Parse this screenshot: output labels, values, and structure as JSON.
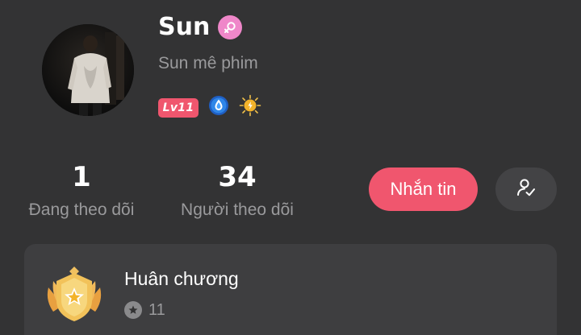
{
  "profile": {
    "username": "Sun",
    "bio": "Sun mê phim",
    "level_badge": "Lv11",
    "gender_icon": "female-symbol-icon",
    "accent_color": "#f0566e",
    "gender_color": "#ef87c9"
  },
  "stats": {
    "following_count": "1",
    "following_label": "Đang theo dõi",
    "followers_count": "34",
    "followers_label": "Người theo dõi"
  },
  "actions": {
    "message_label": "Nhắn tin",
    "follow_icon": "user-check-icon"
  },
  "medals": {
    "title": "Huân chương",
    "count": "11"
  }
}
